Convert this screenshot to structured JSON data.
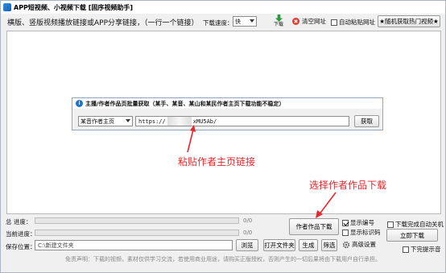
{
  "window": {
    "title": "APP短视频、小视频下载 [固序视频助手]"
  },
  "topbar": {
    "instruction": "横版、竖版视频播放链接或APP分享链接，（一行一个链接）",
    "speed_label": "下载速度：",
    "speed_value": "快",
    "download_label": "下载",
    "clear_label": "清空网址",
    "auto_paste_label": "自动粘贴网址",
    "random_btn_label": "★随机获取热门视频★"
  },
  "dialog": {
    "title": "主播/作者作品页批量获取（某手、某音、某山和某民作者主页下载功能不稳定）",
    "type_select": "某音作者主页",
    "url_prefix": "https://",
    "url_suffix": "xMU5Ab/",
    "fetch_button": "获取"
  },
  "annotations": {
    "paste_hint": "粘贴作者主页链接",
    "select_hint": "选择作者作品下载"
  },
  "progress": {
    "total_label": "总  进度：",
    "total_value": 0,
    "total_text": "0/0",
    "current_label": "当前进度：",
    "current_value": 0,
    "current_text": "0/0"
  },
  "save": {
    "label": "保存位置：",
    "path": "C:\\新建文件夹",
    "browse": "浏览",
    "open_folder": "打开文件夹"
  },
  "buttons": {
    "author_download": "作者作品下载",
    "generate": "生成",
    "select": "筛选",
    "download_now": "立即下载"
  },
  "options": {
    "show_number": "显示编号",
    "show_id": "显示标识码",
    "advanced": "高级设置",
    "auto_shutdown": "下载完成自动关机",
    "notify_sound": "下完提示音"
  },
  "footer": {
    "disclaimer": "免责声明：下载的视频，素材仅供学习交流，若使用商业用途，请购买正版授权，否则产生的一切后果将由下载用户自行承担。"
  },
  "colors": {
    "accent_red": "#e8262b",
    "link_blue": "#1a73d2"
  }
}
